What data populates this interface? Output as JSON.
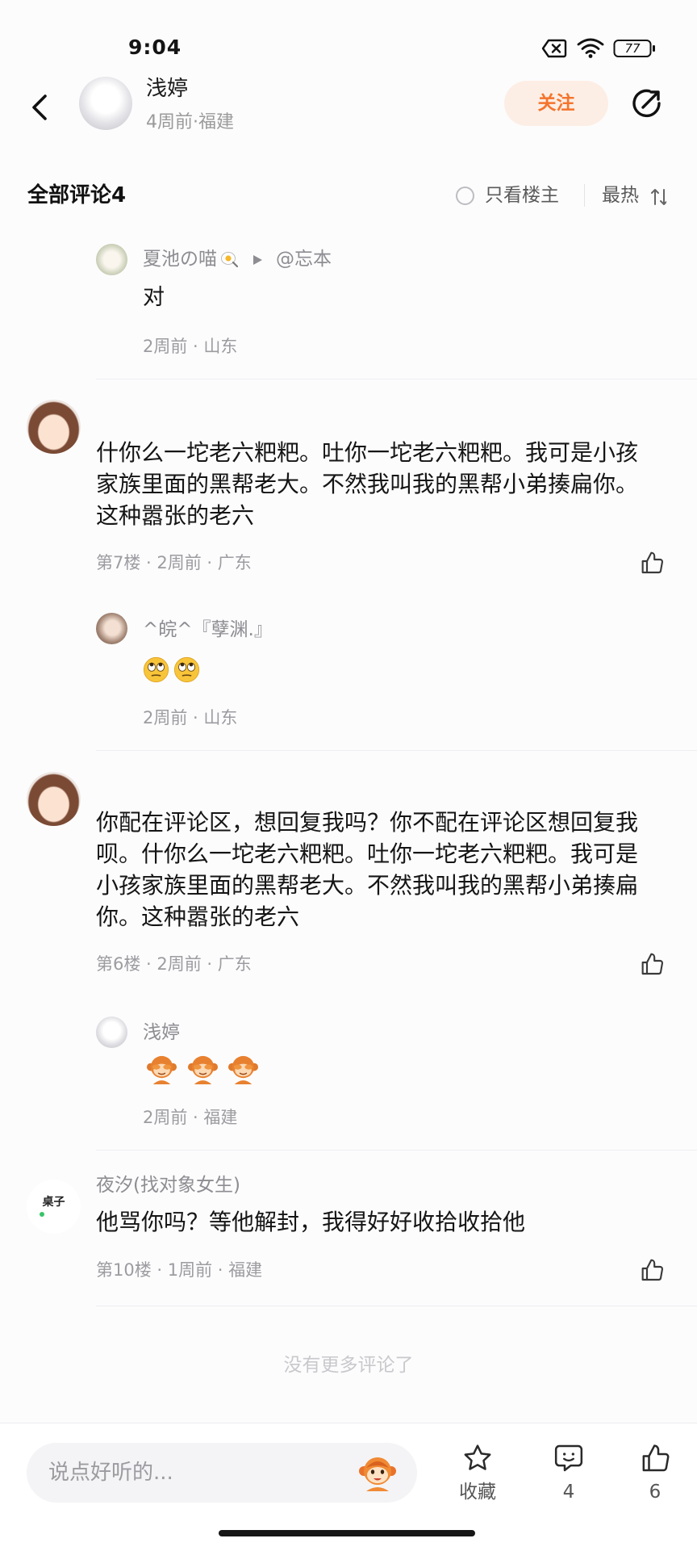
{
  "status_bar": {
    "time": "9:04",
    "battery_level": "77",
    "icons": [
      "no-sim-icon",
      "wifi-icon",
      "battery-icon"
    ]
  },
  "header": {
    "back_icon": "back-arrow-icon",
    "author_name": "浅婷",
    "author_meta": "4周前·福建",
    "follow_label": "关注",
    "share_icon": "share-icon"
  },
  "comments_header": {
    "title": "全部评论4",
    "only_op_label": "只看楼主",
    "sort_label": "最热",
    "sort_icon": "sort-icon"
  },
  "thread": {
    "prev_reply": {
      "name": "夏池の喵",
      "name_icon": "fried-egg-icon",
      "reply_to": "@忘本",
      "text": "对",
      "meta": "2周前 · 山东"
    },
    "comments": [
      {
        "text": "什你么一坨老六粑粑。吐你一坨老六粑粑。我可是小孩家族里面的黑帮老大。不然我叫我的黑帮小弟揍扁你。这种嚣张的老六",
        "meta": "第7楼 · 2周前 · 广东",
        "reply": {
          "name": "^皖^『孽渊.』",
          "emoji": [
            "face-with-rolling-eyes",
            "face-with-rolling-eyes"
          ],
          "meta": "2周前 · 山东"
        }
      },
      {
        "text": "你配在评论区，想回复我吗？你不配在评论区想回复我呗。什你么一坨老六粑粑。吐你一坨老六粑粑。我可是小孩家族里面的黑帮老大。不然我叫我的黑帮小弟揍扁你。这种嚣张的老六",
        "meta": "第6楼 · 2周前 · 广东",
        "reply": {
          "name": "浅婷",
          "stickers": [
            "monkey-sticker",
            "monkey-sticker",
            "monkey-sticker"
          ],
          "meta": "2周前 · 福建"
        }
      },
      {
        "name": "夜汐(找对象女生)",
        "avatar_text": "桌子",
        "text": "他骂你吗？等他解封，我得好好收拾收拾他",
        "meta": "第10楼 · 1周前 · 福建"
      }
    ]
  },
  "footer_note": "没有更多评论了",
  "bottom_bar": {
    "input_placeholder": "说点好听的...",
    "emoji_icon": "monkey-emoji-icon",
    "favorite_label": "收藏",
    "comment_count": "4",
    "like_count": "6"
  },
  "colors": {
    "accent": "#f4742c",
    "follow_bg": "#fdeee5",
    "text_primary": "#141414",
    "text_secondary": "#9c9ca1"
  }
}
